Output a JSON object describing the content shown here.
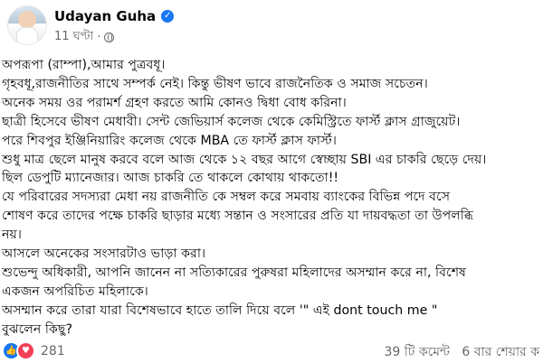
{
  "post": {
    "author": "Udayan Guha",
    "time": "11 ঘণ্টা",
    "separator": "·",
    "lines": [
      "অপরূপা (রাম্পা),আমার পুত্রবধূ।",
      "গৃহবধূ,রাজনীতির সাথে সম্পর্ক নেই। কিন্তু ভীষণ ভাবে রাজনৈতিক ও সমাজ সচেতন।",
      "অনেক সময় ওর পরামর্শ গ্রহণ করতে আমি কোনও দ্বিধা বোধ করিনা।",
      "ছাত্রী হিসেবে ভীষণ মেধাবী।  সেন্ট জেভিয়ার্স কলেজ থেকে কেমিস্ট্রিতে ফার্স্ট ক্লাস গ্রাজুয়েট।",
      "পরে শিবপুর ইঞ্জিনিয়ারিং কলেজ থেকে MBA তে ফার্স্ট ক্লাস ফার্স্ট।",
      " শুধু মাত্র ছেলে মানুষ করবে বলে আজ থেকে ১২ বছর আগে স্বেচ্ছায় SBI এর চাকরি ছেড়ে দেয়।",
      "ছিল ডেপুটি ম্যানেজার।  আজ চাকরি তে থাকলে কোথায় থাকতো!!",
      "যে পরিবারের সদস্যরা  মেধা নয়   রাজনীতি কে  সম্বল করে সমবায় ব্যাংকের বিভিন্ন  পদে বসে",
      "শোষণ করে তাদের পক্ষে চাকরি ছাড়ার মধ্যে সন্তান ও সংসারের প্রতি যা দায়বদ্ধতা তা উপলব্ধি",
      "নয়।",
      "আসলে অনেকের সংসারটাও ভাড়া করা।",
      "শুভেন্দু অধিকারী, আপনি জানেন না সত্যিকারের পুরুষরা মহিলাদের অসম্মান করে না, বিশেষ",
      "একজন অপরিচিত মহিলাকে।",
      "অসম্মান করে তারা যারা বিশেষভাবে হাতে তালি দিয়ে বলে '\" এই dont touch me \"",
      "বুঝলেন কিছু?"
    ]
  },
  "footer": {
    "reaction_count": "281",
    "comments": "39 টি কমেন্ট",
    "shares": "6 বার শেয়ার ক"
  },
  "icons": {
    "like": "like-icon",
    "love": "love-icon",
    "verified": "verified-badge-icon",
    "audience": "globe-icon"
  },
  "colors": {
    "accent": "#1877f2",
    "love": "#f33e58",
    "secondary_text": "#65676b"
  }
}
